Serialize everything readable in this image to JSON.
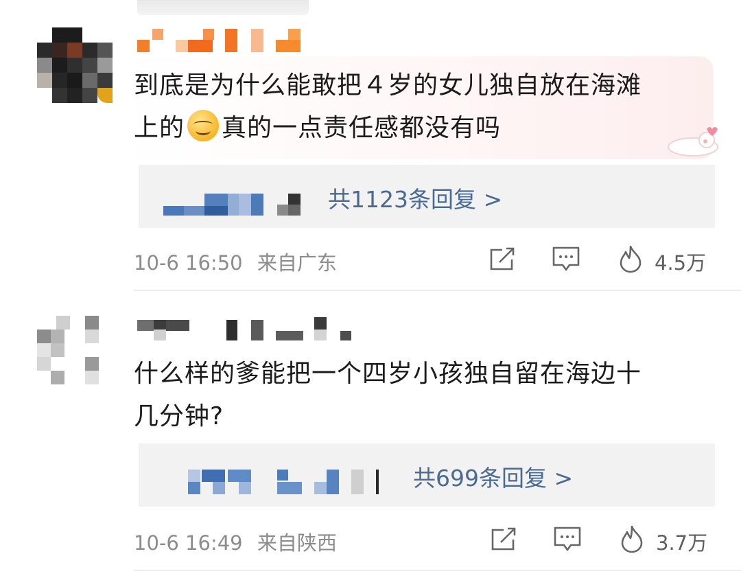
{
  "comments": [
    {
      "text_line1": "到底是为什么能敢把４岁的女儿独自放在海滩",
      "text_line2_before": "上的",
      "text_line2_after": "真的一点责任感都没有吗",
      "reply_label": "共1123条回复 >",
      "time": "10-6 16:50",
      "location": "来自广东",
      "likes": "4.5万",
      "icons": [
        "share-icon",
        "comment-icon",
        "fire-like-icon"
      ]
    },
    {
      "text_line1": "什么样的爹能把一个四岁小孩独自留在海边十",
      "text_line2": "几分钟?",
      "reply_label": "共699条回复 >",
      "time": "10-6 16:49",
      "location": "来自陕西",
      "likes": "3.7万",
      "icons": [
        "share-icon",
        "comment-icon",
        "fire-like-icon"
      ]
    }
  ],
  "colors": {
    "reply_link": "#486a95",
    "reply_box_bg": "#f2f2f2",
    "meta_text": "#8c8c8c",
    "username_blur_1": "#f58a2e",
    "username_blur_2": "#9aa0a6"
  }
}
